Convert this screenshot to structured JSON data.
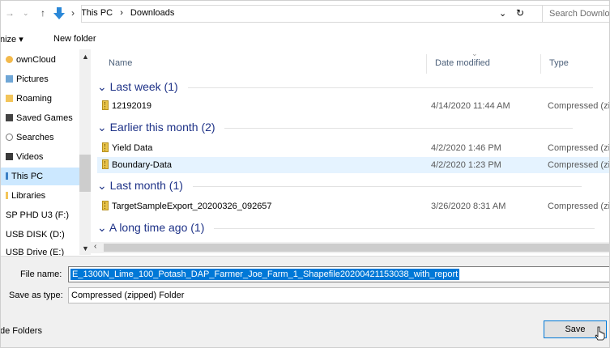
{
  "address_bar": {
    "breadcrumb": [
      "This PC",
      "Downloads"
    ],
    "separator": ">",
    "search_placeholder": "Search Downloads",
    "dropdown_glyph": "⌄",
    "refresh_glyph": "↻"
  },
  "command_bar": {
    "organize_label": "nize ▾",
    "new_folder_label": "New folder"
  },
  "nav_pane": {
    "items": [
      {
        "label": "ownCloud",
        "icon": "cloud-icon"
      },
      {
        "label": "Pictures",
        "icon": "pictures-icon"
      },
      {
        "label": "Roaming",
        "icon": "folder-icon"
      },
      {
        "label": "Saved Games",
        "icon": "saved-games-icon"
      },
      {
        "label": "Searches",
        "icon": "search-icon"
      },
      {
        "label": "Videos",
        "icon": "videos-icon"
      },
      {
        "label": "This PC",
        "icon": "computer-icon"
      },
      {
        "label": "Libraries",
        "icon": "libraries-icon"
      },
      {
        "label": "SP PHD U3 (F:)",
        "icon": ""
      },
      {
        "label": "USB DISK (D:)",
        "icon": ""
      },
      {
        "label": "USB Drive (E:)",
        "icon": ""
      }
    ]
  },
  "file_list": {
    "columns": {
      "name": "Name",
      "date": "Date modified",
      "type": "Type"
    },
    "groups": [
      {
        "label": "Last week (1)",
        "files": [
          {
            "name": "12192019",
            "date": "4/14/2020 11:44 AM",
            "type": "Compressed (zi",
            "selected": false
          }
        ]
      },
      {
        "label": "Earlier this month (2)",
        "files": [
          {
            "name": "Yield Data",
            "date": "4/2/2020 1:46 PM",
            "type": "Compressed (zi",
            "selected": false
          },
          {
            "name": "Boundary-Data",
            "date": "4/2/2020 1:23 PM",
            "type": "Compressed (zi",
            "selected": true
          }
        ]
      },
      {
        "label": "Last month (1)",
        "files": [
          {
            "name": "TargetSampleExport_20200326_092657",
            "date": "3/26/2020 8:31 AM",
            "type": "Compressed (zi",
            "selected": false
          }
        ]
      },
      {
        "label": "A long time ago (1)",
        "files": []
      }
    ]
  },
  "save_form": {
    "file_name_label": "File name:",
    "file_name_value": "E_1300N_Lime_100_Potash_DAP_Farmer_Joe_Farm_1_Shapefile20200421153038_with_report",
    "save_as_type_label": "Save as type:",
    "save_as_type_value": "Compressed (zipped) Folder",
    "hide_folders_label": "de Folders",
    "save_button_label": "Save"
  },
  "colors": {
    "selection_blue": "#0078d7",
    "group_header": "#1e3287",
    "row_selected": "#e5f3ff",
    "nav_selected": "#cce8ff"
  }
}
